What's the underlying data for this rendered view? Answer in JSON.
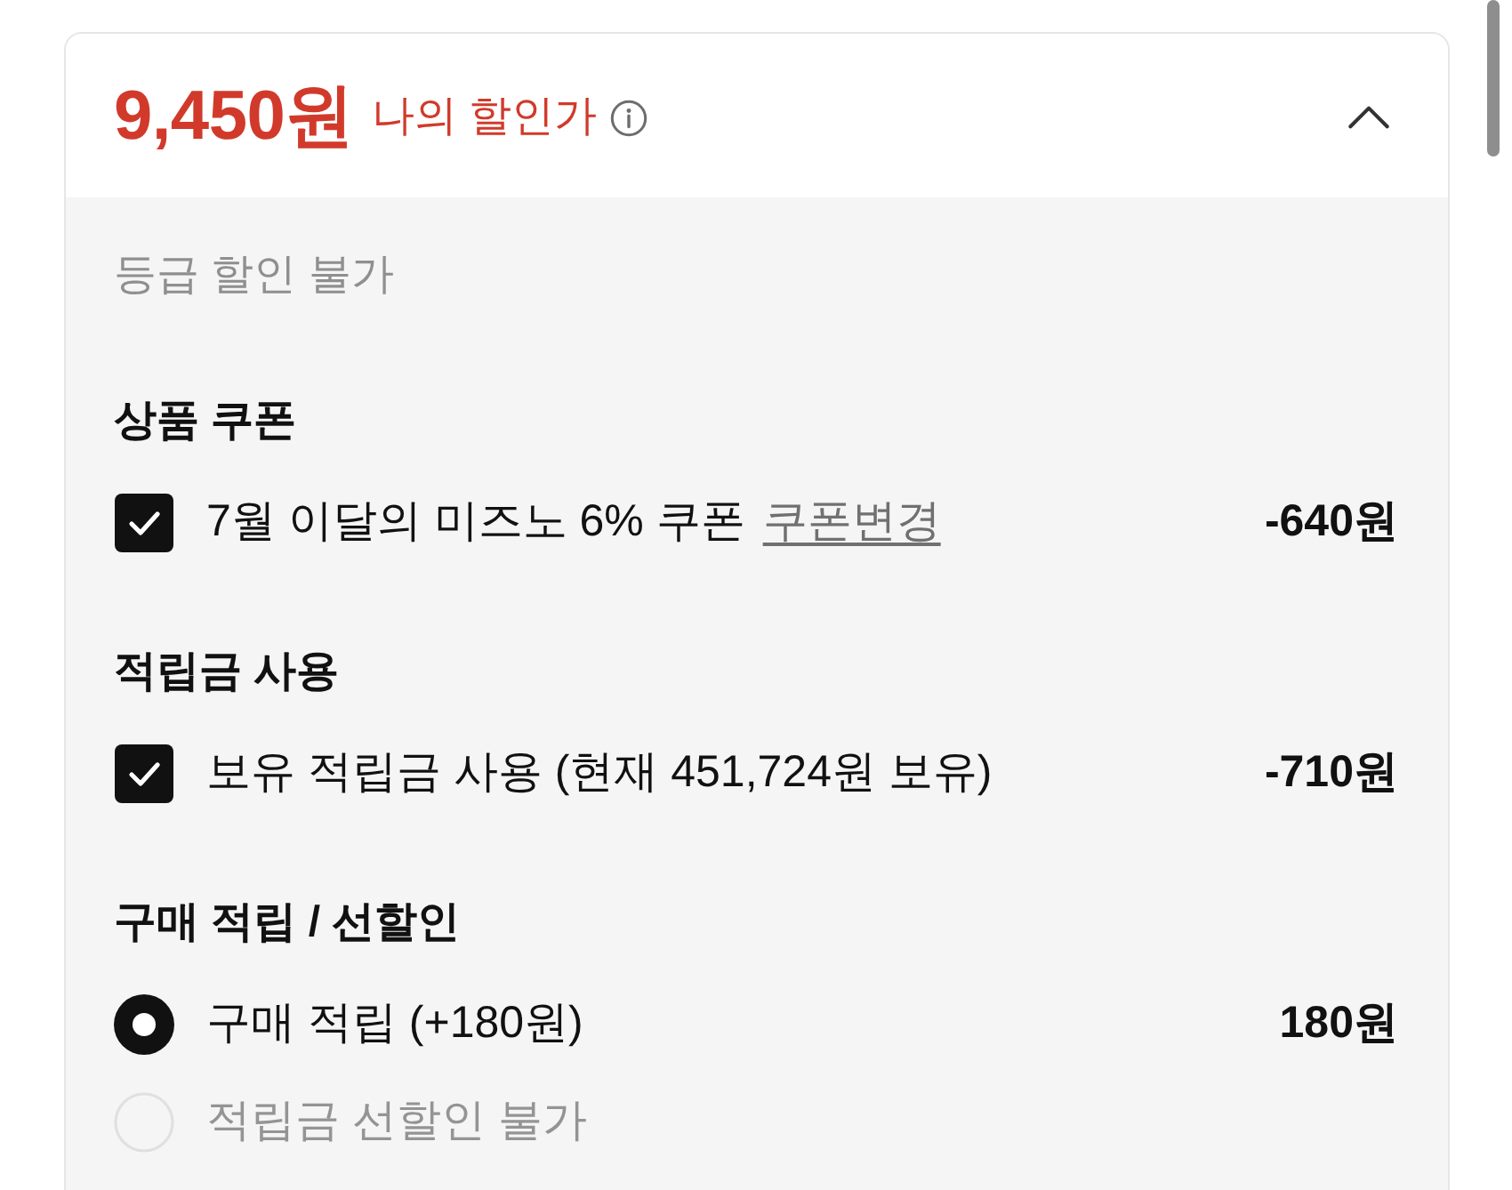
{
  "summary": {
    "price": "9,450원",
    "label": "나의 할인가",
    "expanded": true
  },
  "grade_discount": {
    "text": "등급 할인 불가"
  },
  "sections": [
    {
      "title": "상품 쿠폰",
      "options": [
        {
          "kind": "checkbox",
          "checked": true,
          "disabled": false,
          "label": "7월 이달의 미즈노 6% 쿠폰",
          "link": "쿠폰변경",
          "amount": "-640원"
        }
      ]
    },
    {
      "title": "적립금 사용",
      "options": [
        {
          "kind": "checkbox",
          "checked": true,
          "disabled": false,
          "label": "보유 적립금 사용 (현재 451,724원 보유)",
          "amount": "-710원"
        }
      ]
    },
    {
      "title": "구매 적립 / 선할인",
      "options": [
        {
          "kind": "radio",
          "selected": true,
          "disabled": false,
          "label": "구매 적립 (+180원)",
          "amount": "180원"
        },
        {
          "kind": "radio",
          "selected": false,
          "disabled": true,
          "label": "적립금 선할인 불가"
        }
      ]
    }
  ]
}
